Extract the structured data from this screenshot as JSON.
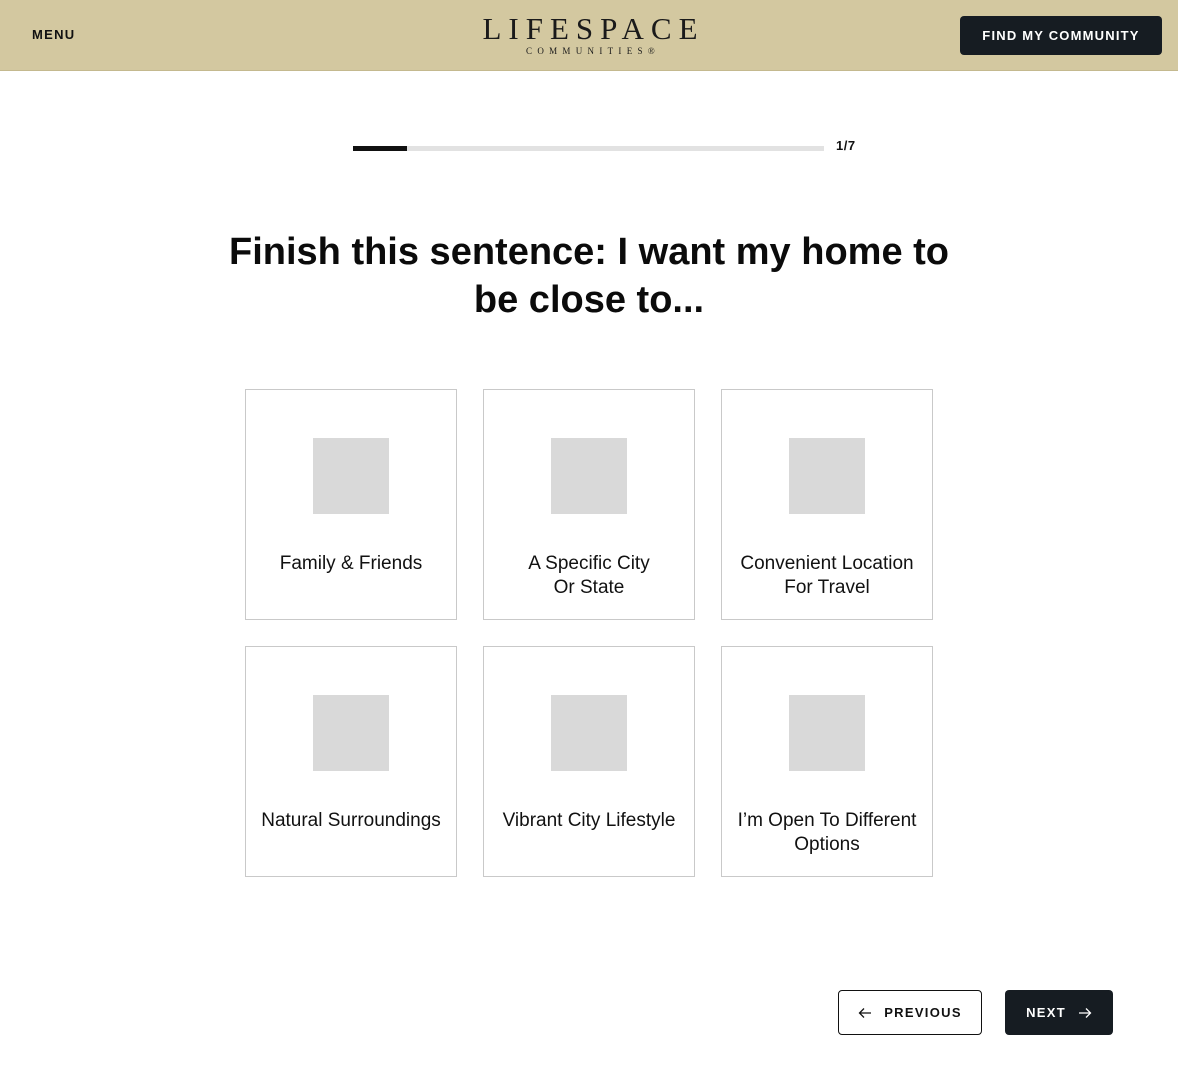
{
  "header": {
    "menu_label": "MENU",
    "logo_main": "LIFESPACE",
    "logo_sub": "COMMUNITIES®",
    "cta_label": "FIND MY COMMUNITY",
    "background_color": "#d3c8a0"
  },
  "progress": {
    "label": "1/7",
    "current_step": 1,
    "total_steps": 7,
    "fraction_complete": 0.115
  },
  "question": {
    "text": "Finish this sentence: I want my home to be close to..."
  },
  "options": [
    {
      "label": "Family & Friends",
      "icon": "image-placeholder"
    },
    {
      "label": "A Specific City Or State",
      "icon": "image-placeholder"
    },
    {
      "label": "Convenient Location For Travel",
      "icon": "image-placeholder"
    },
    {
      "label": "Natural Surroundings",
      "icon": "image-placeholder"
    },
    {
      "label": "Vibrant City Lifestyle",
      "icon": "image-placeholder"
    },
    {
      "label": "I’m Open To Different Options",
      "icon": "image-placeholder"
    }
  ],
  "navigation": {
    "previous_label": "PREVIOUS",
    "previous_icon": "arrow-left-icon",
    "next_label": "NEXT",
    "next_icon": "arrow-right-icon"
  }
}
